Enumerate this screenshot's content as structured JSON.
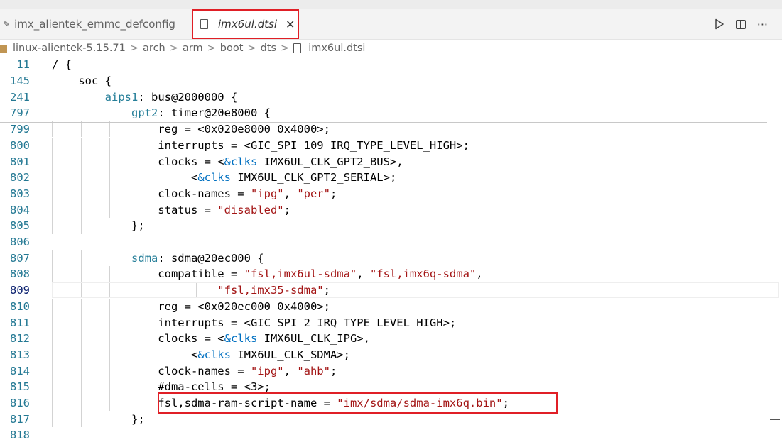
{
  "tabs": [
    {
      "label": "imx_alientek_emmc_defconfig",
      "active": false
    },
    {
      "label": "imx6ul.dtsi",
      "active": true,
      "close": "✕"
    }
  ],
  "actions": {
    "more": "···"
  },
  "breadcrumb": [
    "linux-alientek-5.15.71",
    "arch",
    "arm",
    "boot",
    "dts",
    "imx6ul.dtsi"
  ],
  "breadcrumb_sep": ">",
  "lines": [
    {
      "n": "11",
      "text": "/ {"
    },
    {
      "n": "145",
      "text": "    soc {"
    },
    {
      "n": "241",
      "text": "        aips1: bus@2000000 {"
    },
    {
      "n": "797",
      "text": "            gpt2: timer@20e8000 {"
    },
    {
      "n": "799",
      "text": "                reg = <0x020e8000 0x4000>;"
    },
    {
      "n": "800",
      "text": "                interrupts = <GIC_SPI 109 IRQ_TYPE_LEVEL_HIGH>;"
    },
    {
      "n": "801",
      "text": "                clocks = <&clks IMX6UL_CLK_GPT2_BUS>,"
    },
    {
      "n": "802",
      "text": "                     <&clks IMX6UL_CLK_GPT2_SERIAL>;"
    },
    {
      "n": "803",
      "text": "                clock-names = \"ipg\", \"per\";"
    },
    {
      "n": "804",
      "text": "                status = \"disabled\";"
    },
    {
      "n": "805",
      "text": "            };"
    },
    {
      "n": "806",
      "text": ""
    },
    {
      "n": "807",
      "text": "            sdma: sdma@20ec000 {"
    },
    {
      "n": "808",
      "text": "                compatible = \"fsl,imx6ul-sdma\", \"fsl,imx6q-sdma\","
    },
    {
      "n": "809",
      "text": "                         \"fsl,imx35-sdma\";"
    },
    {
      "n": "810",
      "text": "                reg = <0x020ec000 0x4000>;"
    },
    {
      "n": "811",
      "text": "                interrupts = <GIC_SPI 2 IRQ_TYPE_LEVEL_HIGH>;"
    },
    {
      "n": "812",
      "text": "                clocks = <&clks IMX6UL_CLK_IPG>,"
    },
    {
      "n": "813",
      "text": "                     <&clks IMX6UL_CLK_SDMA>;"
    },
    {
      "n": "814",
      "text": "                clock-names = \"ipg\", \"ahb\";"
    },
    {
      "n": "815",
      "text": "                #dma-cells = <3>;"
    },
    {
      "n": "816",
      "text": "                fsl,sdma-ram-script-name = \"imx/sdma/sdma-imx6q.bin\";"
    },
    {
      "n": "817",
      "text": "            };"
    },
    {
      "n": "818",
      "text": ""
    }
  ],
  "colors": {
    "highlight_box": "#e01f26",
    "line_number": "#237893",
    "string": "#a31515"
  }
}
